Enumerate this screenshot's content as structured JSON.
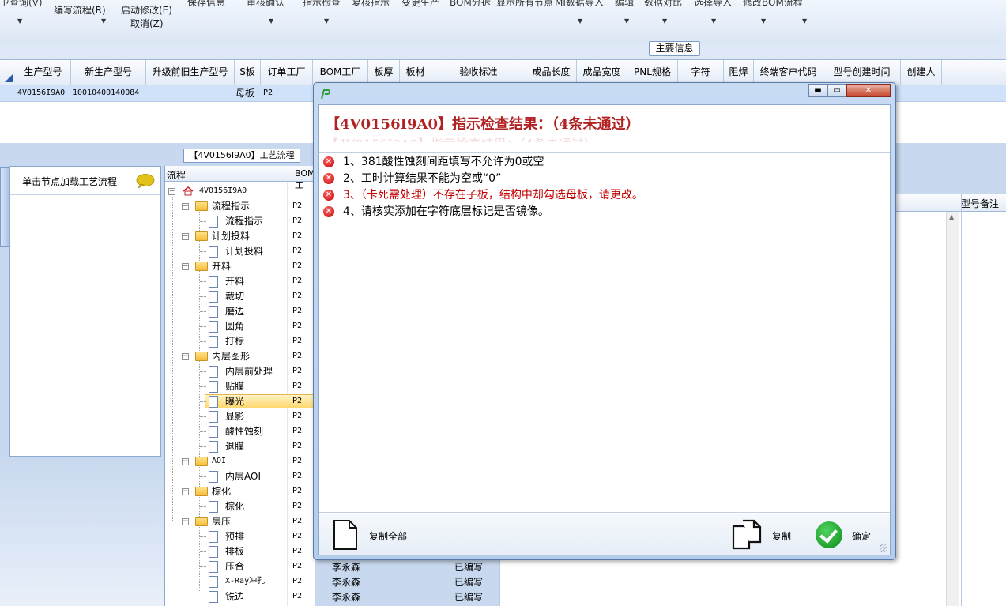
{
  "ribbon": {
    "items": [
      {
        "label": "编写流程(R)"
      },
      {
        "label": "启动修改(E)"
      },
      {
        "label": "取消(Z)"
      }
    ],
    "cut_top_texts": [
      "保存信息",
      "审核确认",
      "指示检查",
      "复核指示",
      "变更生产",
      "BOM分拆",
      "显示所有节点",
      "MI数据导入",
      "编辑",
      "数据对比",
      "选择导入",
      "修改BOM流程"
    ]
  },
  "main_info_label": "主要信息",
  "grid": {
    "columns": [
      "生产型号",
      "新生产型号",
      "升级前旧生产型号",
      "S板",
      "订单工厂",
      "BOM工厂",
      "板厚",
      "板材",
      "验收标准",
      "成品长度",
      "成品宽度",
      "PNL规格",
      "字符",
      "阻焊",
      "终端客户代码",
      "型号创建时间",
      "创建人"
    ],
    "row": {
      "model": "4V0156I9A0",
      "new_model": "10010400140084",
      "s_board": "母板",
      "order_factory": "P2"
    }
  },
  "process_panel": {
    "label": "【4V0156I9A0】工艺流程",
    "left_header": "单击节点加载工艺流程",
    "tree_header": {
      "col1": "流程",
      "col2": "BOM工"
    },
    "root": "4V0156I9A0",
    "nodes": [
      {
        "label": "流程指示",
        "value": "P2",
        "kind": "folder"
      },
      {
        "label": "流程指示",
        "value": "P2",
        "kind": "doc"
      },
      {
        "label": "计划投料",
        "value": "P2",
        "kind": "folder"
      },
      {
        "label": "计划投料",
        "value": "P2",
        "kind": "doc"
      },
      {
        "label": "开料",
        "value": "P2",
        "kind": "folder"
      },
      {
        "label": "开料",
        "value": "P2",
        "kind": "doc"
      },
      {
        "label": "裁切",
        "value": "P2",
        "kind": "doc"
      },
      {
        "label": "磨边",
        "value": "P2",
        "kind": "doc"
      },
      {
        "label": "圆角",
        "value": "P2",
        "kind": "doc"
      },
      {
        "label": "打标",
        "value": "P2",
        "kind": "doc"
      },
      {
        "label": "内层图形",
        "value": "P2",
        "kind": "folder"
      },
      {
        "label": "内层前处理",
        "value": "P2",
        "kind": "doc"
      },
      {
        "label": "贴膜",
        "value": "P2",
        "kind": "doc"
      },
      {
        "label": "曝光",
        "value": "P2",
        "kind": "doc"
      },
      {
        "label": "显影",
        "value": "P2",
        "kind": "doc"
      },
      {
        "label": "酸性蚀刻",
        "value": "P2",
        "kind": "doc"
      },
      {
        "label": "退膜",
        "value": "P2",
        "kind": "doc"
      },
      {
        "label": "AOI",
        "value": "P2",
        "kind": "folder"
      },
      {
        "label": "内层AOI",
        "value": "P2",
        "kind": "doc"
      },
      {
        "label": "棕化",
        "value": "P2",
        "kind": "folder"
      },
      {
        "label": "棕化",
        "value": "P2",
        "kind": "doc"
      },
      {
        "label": "层压",
        "value": "P2",
        "kind": "folder"
      },
      {
        "label": "预排",
        "value": "P2",
        "kind": "doc"
      },
      {
        "label": "排板",
        "value": "P2",
        "kind": "doc"
      },
      {
        "label": "压合",
        "value": "P2",
        "kind": "doc"
      },
      {
        "label": "X-Ray冲孔",
        "value": "P2",
        "kind": "doc"
      },
      {
        "label": "铣边",
        "value": "P2",
        "kind": "doc"
      }
    ],
    "extra_rows": [
      {
        "name": "李永森",
        "state": "已编写"
      },
      {
        "name": "李永森",
        "state": "已编写"
      },
      {
        "name": "李永森",
        "state": "已编写"
      }
    ]
  },
  "right_grid_header": "型号备注",
  "dialog": {
    "title": "【4V0156I9A0】指示检查结果：（4条未通过）",
    "ghost": "【4V0156I9A0】指示检查结果：（4条未通过）",
    "window_buttons": {
      "minimize": "▬",
      "maximize": "▭",
      "close": "✕"
    },
    "messages": [
      {
        "text": "1、381酸性蚀刻间距填写不允许为0或空",
        "style": "normal"
      },
      {
        "text": "2、工时计算结果不能为空或“0”",
        "style": "normal"
      },
      {
        "text": "3、（卡死需处理）不存在子板，结构中却勾选母板，请更改。",
        "style": "red"
      },
      {
        "text": "4、请核实添加在字符底层标记是否镜像。",
        "style": "normal"
      }
    ],
    "copy_all_label": "复制全部",
    "copy_label": "复制",
    "ok_label": "确定"
  }
}
